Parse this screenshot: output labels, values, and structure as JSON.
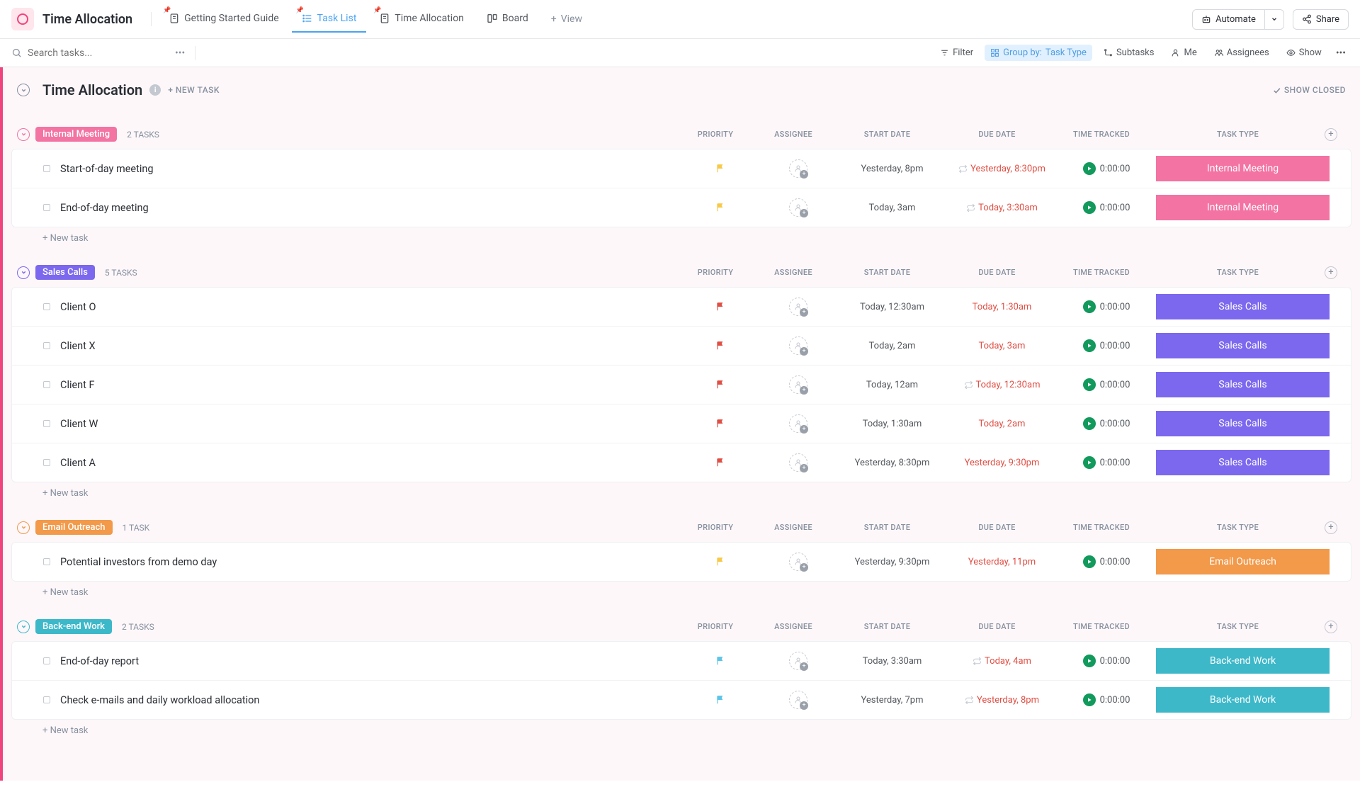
{
  "header": {
    "title": "Time Allocation",
    "tabs": [
      {
        "label": "Getting Started Guide",
        "icon": "doc"
      },
      {
        "label": "Task List",
        "icon": "list",
        "active": true
      },
      {
        "label": "Time Allocation",
        "icon": "doc"
      },
      {
        "label": "Board",
        "icon": "board"
      }
    ],
    "add_view": "View",
    "automate": "Automate",
    "share": "Share"
  },
  "toolbar": {
    "search_placeholder": "Search tasks...",
    "filter": "Filter",
    "group_by_label": "Group by:",
    "group_by_value": "Task Type",
    "subtasks": "Subtasks",
    "me": "Me",
    "assignees": "Assignees",
    "show": "Show"
  },
  "list": {
    "title": "Time Allocation",
    "new_task": "+ NEW TASK",
    "show_closed": "SHOW CLOSED",
    "columns": {
      "priority": "PRIORITY",
      "assignee": "ASSIGNEE",
      "start": "START DATE",
      "due": "DUE DATE",
      "time": "TIME TRACKED",
      "type": "TASK TYPE"
    },
    "new_task_row": "+ New task"
  },
  "colors": {
    "internal_meeting": "#f373a2",
    "sales_calls": "#7b68ee",
    "email_outreach": "#f2994a",
    "backend_work": "#3db8c9",
    "flag_yellow": "#f7c948",
    "flag_red": "#e04f44",
    "flag_blue": "#5bc5e8"
  },
  "groups": [
    {
      "name": "Internal Meeting",
      "color": "#f373a2",
      "count": "2 TASKS",
      "tasks": [
        {
          "name": "Start-of-day meeting",
          "flag": "#f7c948",
          "start": "Yesterday, 8pm",
          "due": "Yesterday, 8:30pm",
          "due_overdue": true,
          "recur": true,
          "time": "0:00:00",
          "type": "Internal Meeting"
        },
        {
          "name": "End-of-day meeting",
          "flag": "#f7c948",
          "start": "Today, 3am",
          "due": "Today, 3:30am",
          "due_overdue": true,
          "recur": true,
          "time": "0:00:00",
          "type": "Internal Meeting"
        }
      ]
    },
    {
      "name": "Sales Calls",
      "color": "#7b68ee",
      "count": "5 TASKS",
      "tasks": [
        {
          "name": "Client O",
          "flag": "#e04f44",
          "start": "Today, 12:30am",
          "due": "Today, 1:30am",
          "due_overdue": true,
          "recur": false,
          "time": "0:00:00",
          "type": "Sales Calls"
        },
        {
          "name": "Client X",
          "flag": "#e04f44",
          "start": "Today, 2am",
          "due": "Today, 3am",
          "due_overdue": true,
          "recur": false,
          "time": "0:00:00",
          "type": "Sales Calls"
        },
        {
          "name": "Client F",
          "flag": "#e04f44",
          "start": "Today, 12am",
          "due": "Today, 12:30am",
          "due_overdue": true,
          "recur": true,
          "time": "0:00:00",
          "type": "Sales Calls"
        },
        {
          "name": "Client W",
          "flag": "#e04f44",
          "start": "Today, 1:30am",
          "due": "Today, 2am",
          "due_overdue": true,
          "recur": false,
          "time": "0:00:00",
          "type": "Sales Calls"
        },
        {
          "name": "Client A",
          "flag": "#e04f44",
          "start": "Yesterday, 8:30pm",
          "due": "Yesterday, 9:30pm",
          "due_overdue": true,
          "recur": false,
          "time": "0:00:00",
          "type": "Sales Calls"
        }
      ]
    },
    {
      "name": "Email Outreach",
      "color": "#f2994a",
      "count": "1 TASK",
      "tasks": [
        {
          "name": "Potential investors from demo day",
          "flag": "#f7c948",
          "start": "Yesterday, 9:30pm",
          "due": "Yesterday, 11pm",
          "due_overdue": true,
          "recur": false,
          "time": "0:00:00",
          "type": "Email Outreach"
        }
      ]
    },
    {
      "name": "Back-end Work",
      "color": "#3db8c9",
      "count": "2 TASKS",
      "tasks": [
        {
          "name": "End-of-day report",
          "flag": "#5bc5e8",
          "start": "Today, 3:30am",
          "due": "Today, 4am",
          "due_overdue": true,
          "recur": true,
          "time": "0:00:00",
          "type": "Back-end Work"
        },
        {
          "name": "Check e-mails and daily workload allocation",
          "flag": "#5bc5e8",
          "start": "Yesterday, 7pm",
          "due": "Yesterday, 8pm",
          "due_overdue": true,
          "recur": true,
          "time": "0:00:00",
          "type": "Back-end Work"
        }
      ]
    }
  ]
}
